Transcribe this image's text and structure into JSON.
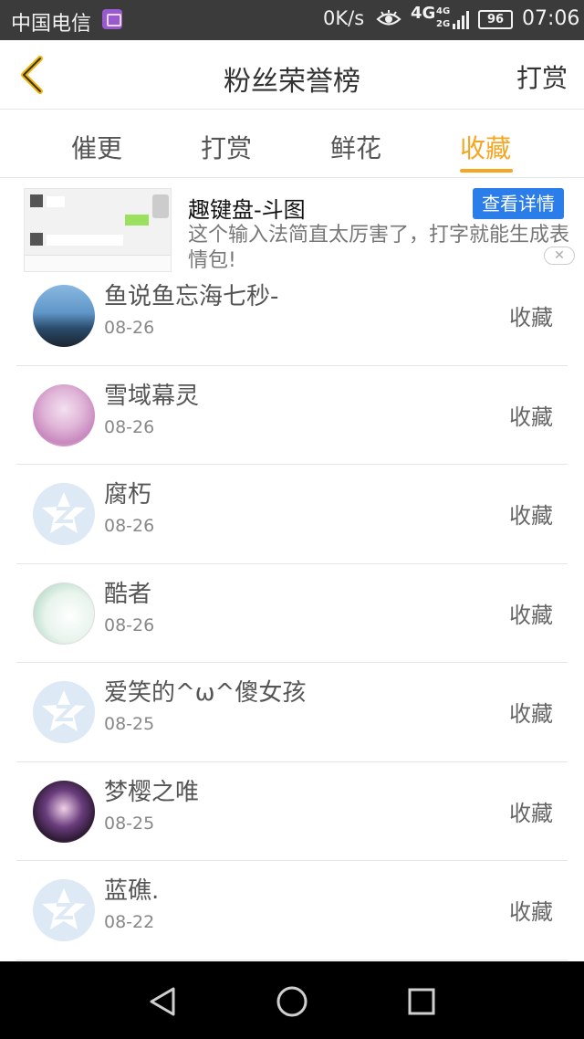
{
  "status_bar": {
    "carrier": "中国电信",
    "net_speed": "0K/s",
    "network": "4G",
    "network_small_top": "4G",
    "network_small_bottom": "2G",
    "battery": "96",
    "time": "07:06"
  },
  "header": {
    "title": "粉丝荣誉榜",
    "action_label": "打赏",
    "back_icon": "chevron-left-icon",
    "accent_color": "#f5a623"
  },
  "tabs": [
    {
      "label": "催更",
      "active": false
    },
    {
      "label": "打赏",
      "active": false
    },
    {
      "label": "鲜花",
      "active": false
    },
    {
      "label": "收藏",
      "active": true
    }
  ],
  "ad": {
    "title": "趣键盘-斗图",
    "button_label": "查看详情",
    "description": "这个输入法简直太厉害了，打字就能生成表情包!",
    "close_icon": "close-icon"
  },
  "fans": [
    {
      "name": "鱼说鱼忘海七秒-",
      "date": "08-26",
      "action": "收藏",
      "avatar": "photo"
    },
    {
      "name": "雪域幕灵",
      "date": "08-26",
      "action": "收藏",
      "avatar": "photo"
    },
    {
      "name": "腐朽",
      "date": "08-26",
      "action": "收藏",
      "avatar": "default-star-icon"
    },
    {
      "name": "酷者",
      "date": "08-26",
      "action": "收藏",
      "avatar": "photo"
    },
    {
      "name": "爱笑的^ω^傻女孩",
      "date": "08-25",
      "action": "收藏",
      "avatar": "default-star-icon"
    },
    {
      "name": "梦樱之唯",
      "date": "08-25",
      "action": "收藏",
      "avatar": "photo"
    },
    {
      "name": "蓝礁.",
      "date": "08-22",
      "action": "收藏",
      "avatar": "default-star-icon"
    }
  ],
  "nav_bar": {
    "back_icon": "triangle-back-icon",
    "home_icon": "circle-home-icon",
    "recents_icon": "square-recents-icon"
  }
}
